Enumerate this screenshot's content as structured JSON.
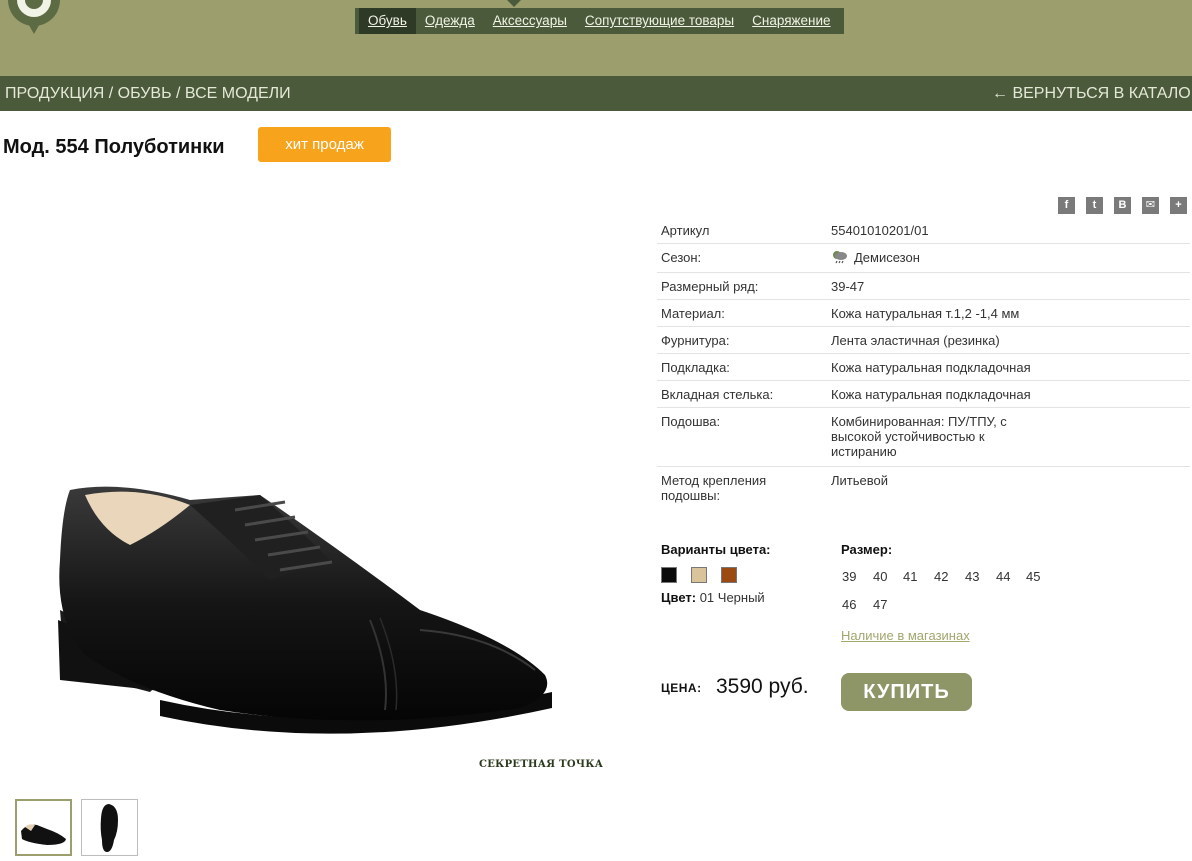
{
  "nav": {
    "items": [
      {
        "label": "Обувь",
        "active": true
      },
      {
        "label": "Одежда"
      },
      {
        "label": "Аксессуары"
      },
      {
        "label": "Сопутствующие товары"
      },
      {
        "label": "Снаряжение"
      }
    ]
  },
  "breadcrumb": {
    "items": [
      "ПРОДУКЦИЯ",
      "ОБУВЬ",
      "ВСЕ МОДЕЛИ"
    ],
    "separator": " / ",
    "back_label": "← ВЕРНУТЬСЯ В КАТАЛОГ"
  },
  "product": {
    "title": "Мод. 554 Полуботинки",
    "badge": "хит продаж",
    "watermark": "СЕКРЕТНАЯ ТОЧКА"
  },
  "social": [
    {
      "icon": "facebook-icon",
      "glyph": "f"
    },
    {
      "icon": "twitter-icon",
      "glyph": "t"
    },
    {
      "icon": "vkontakte-icon",
      "glyph": "B"
    },
    {
      "icon": "mail-icon",
      "glyph": "✉"
    },
    {
      "icon": "plus-icon",
      "glyph": "+"
    }
  ],
  "specs": [
    {
      "key": "Артикул",
      "value": "55401010201/01"
    },
    {
      "key": "Сезон:",
      "value": "Демисезон",
      "icon": "season-icon"
    },
    {
      "key": "Размерный ряд:",
      "value": "39-47"
    },
    {
      "key": "Материал:",
      "value": "Кожа натуральная т.1,2 -1,4 мм"
    },
    {
      "key": "Фурнитура:",
      "value": "Лента эластичная (резинка)"
    },
    {
      "key": "Подкладка:",
      "value": "Кожа натуральная подкладочная"
    },
    {
      "key": "Вкладная стелька:",
      "value": "Кожа натуральная подкладочная"
    },
    {
      "key": "Подошва:",
      "value": "Комбинированная: ПУ/ТПУ, с высокой устойчивостью к истиранию"
    },
    {
      "key": "Метод крепления подошвы:",
      "value": "Литьевой"
    }
  ],
  "colors": {
    "label": "Варианты цвета:",
    "swatches": [
      "#0a0a0a",
      "#d9c39a",
      "#9a4a12"
    ],
    "current_label": "Цвет:",
    "current_value": "01 Черный"
  },
  "sizes": {
    "label": "Размер:",
    "values": [
      "39",
      "40",
      "41",
      "42",
      "43",
      "44",
      "45",
      "46",
      "47"
    ]
  },
  "stock_link": "Наличие в магазинах",
  "price": {
    "label": "ЦЕНА:",
    "value": "3590 руб."
  },
  "buy_label": "КУПИТЬ"
}
